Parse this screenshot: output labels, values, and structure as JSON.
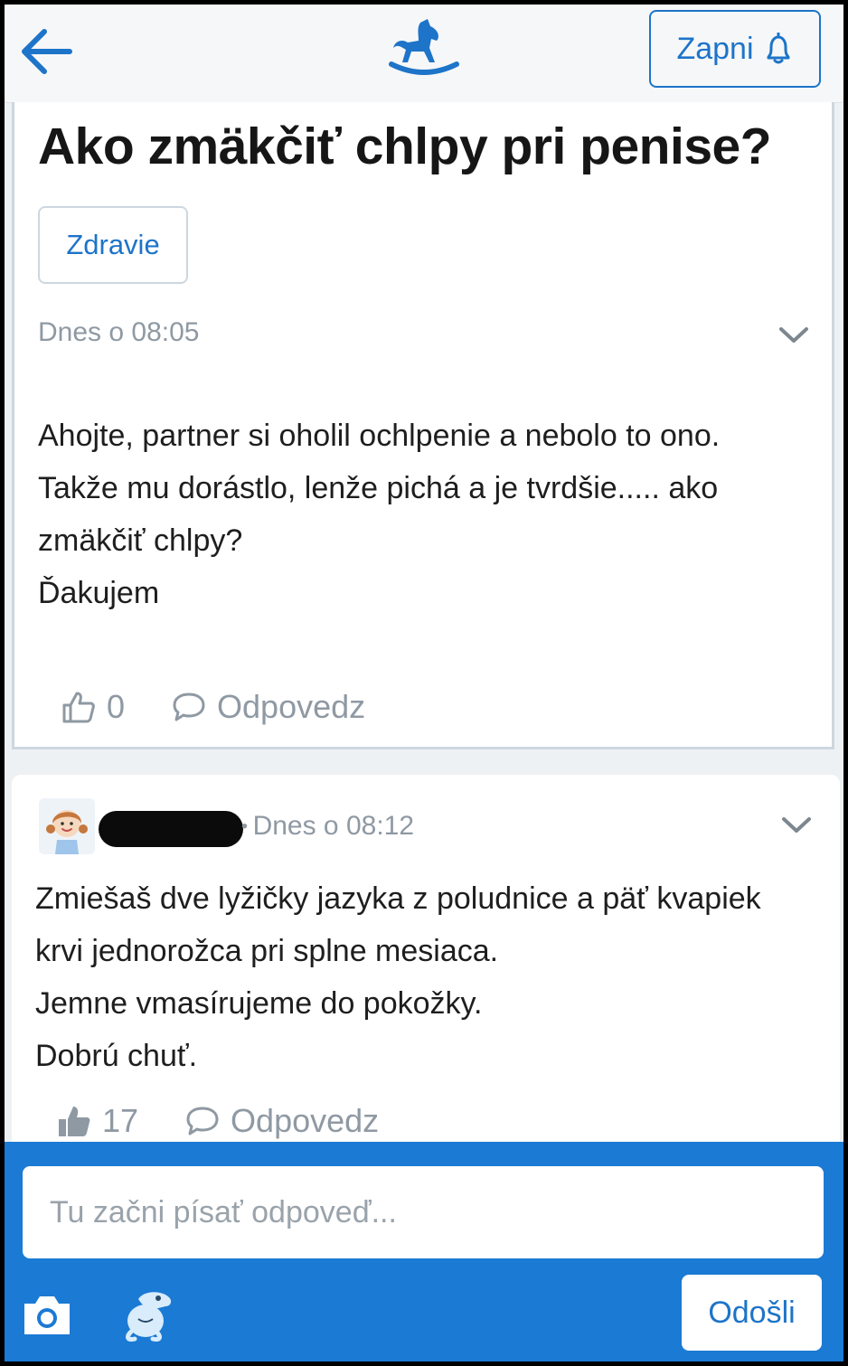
{
  "header": {
    "back_icon": "arrow-left-icon",
    "logo_icon": "rocking-horse-icon",
    "subscribe_label": "Zapni",
    "subscribe_icon": "bell-icon",
    "accent_color": "#1d74c9"
  },
  "question": {
    "title": "Ako zmäkčiť chlpy pri penise?",
    "category": "Zdravie",
    "time": "Dnes o 08:05",
    "body_lines": [
      "Ahojte, partner si oholil ochlpenie a nebolo to ono.",
      "Takže mu dorástlo, lenže pichá a je tvrdšie..... ako",
      "zmäkčiť chlpy?",
      "Ďakujem"
    ],
    "likes": "0",
    "reply_label": "Odpovedz"
  },
  "answer": {
    "avatar_icon": "girl-avatar-icon",
    "time": "Dnes o 08:12",
    "body_lines": [
      "Zmiešaš dve lyžičky jazyka z poludnice a päť kvapiek",
      "krvi jednorožca pri splne mesiaca.",
      "Jemne vmasírujeme do pokožky.",
      "Dobrú chuť."
    ],
    "likes": "17",
    "reply_label": "Odpovedz"
  },
  "composer": {
    "placeholder": "Tu začni písať odpoveď...",
    "send_label": "Odošli",
    "camera_icon": "camera-icon",
    "mascot_icon": "mascot-icon",
    "bar_color": "#1b7ad4"
  }
}
